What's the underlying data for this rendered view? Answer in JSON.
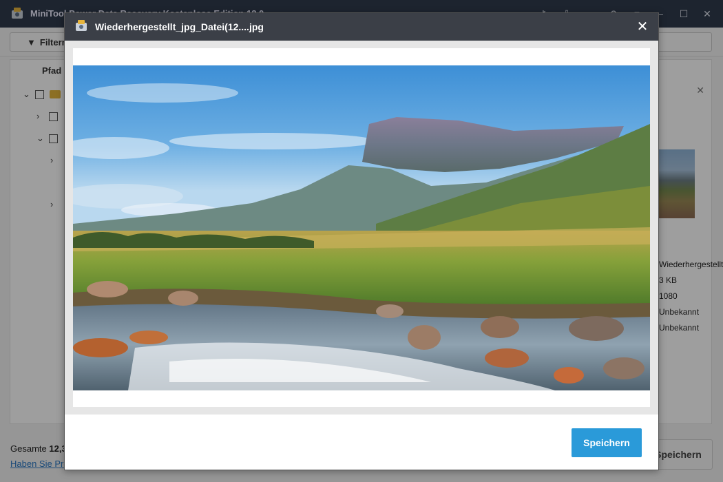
{
  "app": {
    "title": "MiniTool Power Data Recovery Kostenlose Edition 12.0",
    "window_controls": [
      "key-icon",
      "download-icon",
      "support-icon",
      "help-icon",
      "menu-icon",
      "minimize-icon",
      "maximize-icon",
      "close-icon"
    ]
  },
  "toolbar": {
    "filter_label": "Filtern"
  },
  "panel": {
    "path_header": "Pfad",
    "info_lines": [
      "Wiederhergestellt",
      "3 KB",
      "1080",
      "Unbekannt",
      "Unbekannt"
    ]
  },
  "bottom": {
    "total_label": "Gesamte",
    "total_value": "12,3",
    "help_link": "Haben Sie Probleme?",
    "save_label": "Speichern"
  },
  "modal": {
    "title": "Wiederhergestellt_jpg_Datei(12....jpg",
    "save_label": "Speichern",
    "image_subject": "mountain-river-landscape"
  },
  "colors": {
    "titlebar": "#2f3a4c",
    "modal_header": "#3b3f47",
    "accent": "#2a9ad9"
  }
}
